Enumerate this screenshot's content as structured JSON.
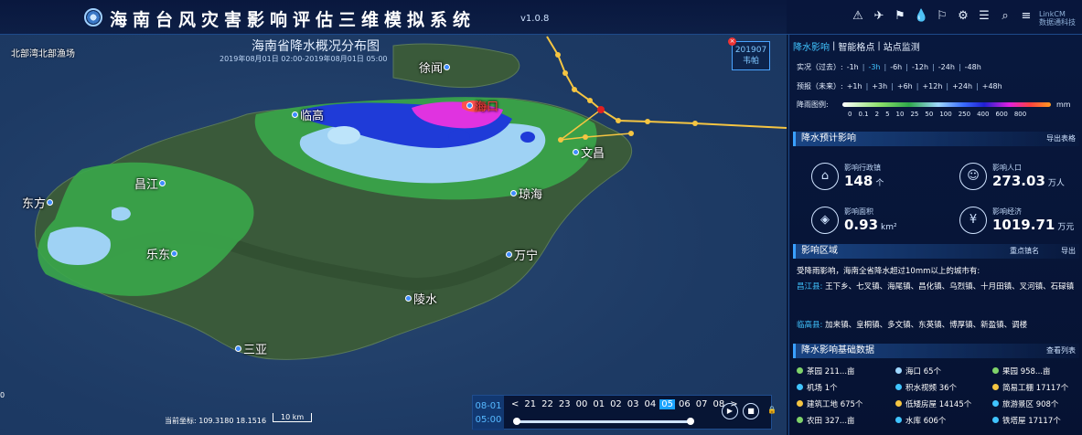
{
  "header": {
    "title": "海南台风灾害影响评估三维模拟系统",
    "version": "v1.0.8",
    "brand_line1": "LinkCM",
    "brand_line2": "数据通科技",
    "tool_icons": [
      "alarm-icon",
      "satellite-icon",
      "flag-icon",
      "rain-drop-icon",
      "banner-icon",
      "settings-icon",
      "layers-icon",
      "search-icon",
      "menu-icon"
    ]
  },
  "map": {
    "title": "海南省降水概况分布图",
    "subtitle": "2019年08月01日 02:00-2019年08月01日 05:00",
    "corner_label": "北部湾北部渔场",
    "cities": [
      "徐闻",
      "海口",
      "临高",
      "文昌",
      "昌江",
      "琼海",
      "东方",
      "乐东",
      "万宁",
      "陵水",
      "三亚"
    ],
    "typhoon_id": "201907",
    "typhoon_name": "韦帕",
    "coords_label": "当前坐标: 109.3180 18.1516",
    "scale_label": "10 km",
    "mini_label": "0"
  },
  "timeline": {
    "date": "08-01",
    "time": "05:00",
    "hours": [
      "21",
      "22",
      "23",
      "00",
      "01",
      "02",
      "03",
      "04",
      "05",
      "06",
      "07",
      "08"
    ],
    "active_hour": "05",
    "prev": "<",
    "next": ">"
  },
  "panel": {
    "tabs": [
      "降水影响",
      "智能格点",
      "站点监测"
    ],
    "observed_label": "实况（过去）:",
    "observed": [
      "-1h",
      "-3h",
      "-6h",
      "-12h",
      "-24h",
      "-48h"
    ],
    "observed_active": "-3h",
    "forecast_label": "预报（未来）:",
    "forecast": [
      "+1h",
      "+3h",
      "+6h",
      "+12h",
      "+24h",
      "+48h"
    ],
    "legend_label": "降雨图例:",
    "legend_values": [
      "0",
      "0.1",
      "2",
      "5",
      "10",
      "25",
      "50",
      "100",
      "250",
      "400",
      "600",
      "800"
    ],
    "legend_unit": "mm",
    "impact_title": "降水预计影响",
    "export_tables": "导出表格",
    "stats": [
      {
        "label": "影响行政镇",
        "value": "148",
        "unit": "个",
        "icon": "town-icon"
      },
      {
        "label": "影响人口",
        "value": "273.03",
        "unit": "万人",
        "icon": "people-icon"
      },
      {
        "label": "影响面积",
        "value": "0.93",
        "unit": "km²",
        "icon": "area-icon"
      },
      {
        "label": "影响经济",
        "value": "1019.71",
        "unit": "万元",
        "icon": "money-icon"
      }
    ],
    "region_title": "影响区域",
    "region_action1": "重点镇名",
    "region_action2": "导出",
    "region_intro": "受降雨影响，海南全省降水超过10mm以上的城市有:",
    "region_lines": [
      {
        "city": "昌江县:",
        "towns": "王下乡、七叉镇、海尾镇、昌化镇、乌烈镇、十月田镇、叉河镇、石碌镇"
      },
      {
        "city": "临高县:",
        "towns": "加来镇、皇桐镇、多文镇、东英镇、博厚镇、新盈镇、调楼"
      }
    ],
    "base_title": "降水影响基础数据",
    "base_action": "查看列表",
    "base_items": [
      {
        "label": "茶园 211...亩",
        "color": "#7fd36a"
      },
      {
        "label": "海口 65个",
        "color": "#9fd8ff"
      },
      {
        "label": "果园 958...亩",
        "color": "#7fd36a"
      },
      {
        "label": "机场 1个",
        "color": "#40c4ff"
      },
      {
        "label": "积水视频 36个",
        "color": "#40c4ff"
      },
      {
        "label": "简易工棚 17117个",
        "color": "#f5c542"
      },
      {
        "label": "建筑工地 675个",
        "color": "#f5c542"
      },
      {
        "label": "低矮房屋 14145个",
        "color": "#f5c542"
      },
      {
        "label": "旅游景区 908个",
        "color": "#40c4ff"
      },
      {
        "label": "农田 327...亩",
        "color": "#7fd36a"
      },
      {
        "label": "水库 606个",
        "color": "#40c4ff"
      },
      {
        "label": "铁塔屋 17117个",
        "color": "#40c4ff"
      }
    ]
  }
}
